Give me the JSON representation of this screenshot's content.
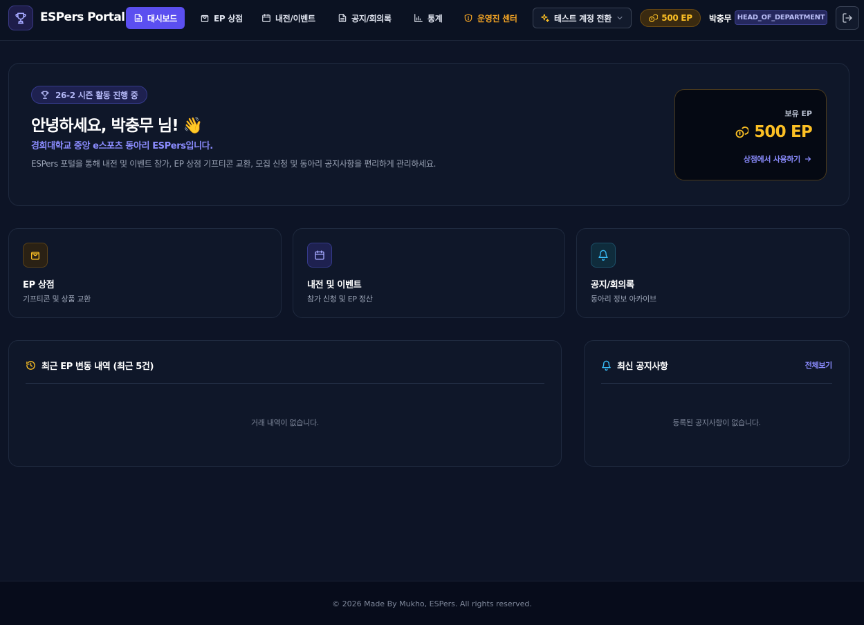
{
  "header": {
    "brand": "ESPers Portal",
    "nav": [
      {
        "label": "대시보드"
      },
      {
        "label": "EP 상점"
      },
      {
        "label": "내전/이벤트"
      },
      {
        "label": "공지/회의록"
      },
      {
        "label": "통계"
      },
      {
        "label": "운영진 센터"
      }
    ],
    "switch_account_label": "테스트 계정 전환",
    "ep_balance": "500 EP",
    "user_name": "박충무",
    "user_role": "HEAD_OF_DEPARTMENT"
  },
  "hero": {
    "season_badge": "26-2 시즌 활동 진행 중",
    "greeting": "안녕하세요, 박충무 님! 👋",
    "sub_heading": "경희대학교 중앙 e스포츠 동아리 ESPers입니다.",
    "description": "ESPers 포털을 통해 내전 및 이벤트 참가, EP 상점 기프티콘 교환, 모집 신청 및 동아리 공지사항을 편리하게 관리하세요.",
    "ep_card": {
      "label": "보유 EP",
      "value": "500 EP",
      "link": "상점에서 사용하기"
    }
  },
  "quick_links": [
    {
      "title": "EP 상점",
      "desc": "기프티콘 및 상품 교환"
    },
    {
      "title": "내전 및 이벤트",
      "desc": "참가 신청 및 EP 정산"
    },
    {
      "title": "공지/회의록",
      "desc": "동아리 정보 아카이브"
    }
  ],
  "ep_history": {
    "title": "최근 EP 변동 내역 (최근 5건)",
    "empty": "거래 내역이 없습니다."
  },
  "notices": {
    "title": "최신 공지사항",
    "view_all": "전체보기",
    "empty": "등록된 공지사항이 없습니다."
  },
  "footer": {
    "text": "© 2026 Made By Mukho, ESPers. All rights reserved."
  },
  "colors": {
    "accent": "#5b4ff0",
    "ep_gold": "#fbbf24",
    "link": "#8b8cff",
    "admin_orange": "#f5a524"
  }
}
